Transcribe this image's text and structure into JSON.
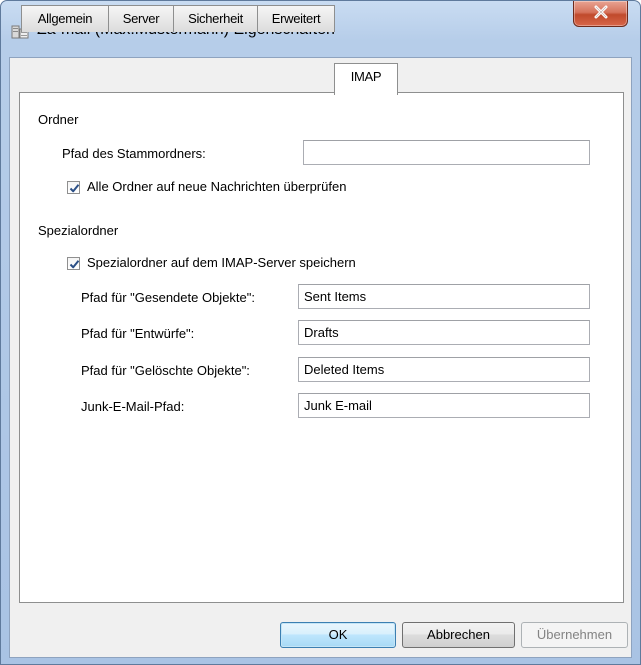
{
  "window": {
    "title": "Za-mail (Max.Mustermann) Eigenschaften"
  },
  "tabs": [
    {
      "label": "Allgemein",
      "active": false
    },
    {
      "label": "Server",
      "active": false
    },
    {
      "label": "Sicherheit",
      "active": false
    },
    {
      "label": "Erweitert",
      "active": false
    },
    {
      "label": "IMAP",
      "active": true
    }
  ],
  "ordner": {
    "heading": "Ordner",
    "root_path_label": "Pfad des Stammordners:",
    "root_path_value": "",
    "check_all_label": "Alle Ordner auf neue Nachrichten überprüfen",
    "check_all_checked": true
  },
  "spezial": {
    "heading": "Spezialordner",
    "store_label": "Spezialordner auf dem IMAP-Server speichern",
    "store_checked": true,
    "sent_label": "Pfad für \"Gesendete Objekte\":",
    "sent_value": "Sent Items",
    "drafts_label": "Pfad für \"Entwürfe\":",
    "drafts_value": "Drafts",
    "deleted_label": "Pfad für \"Gelöschte Objekte\":",
    "deleted_value": "Deleted Items",
    "junk_label": "Junk-E-Mail-Pfad:",
    "junk_value": "Junk E-mail"
  },
  "buttons": {
    "ok": "OK",
    "cancel": "Abbrechen",
    "apply": "Übernehmen"
  },
  "icons": {
    "title": "mail-account-icon",
    "close": "close-icon",
    "check": "checkmark-icon"
  },
  "colors": {
    "title_gradient_top": "#c9dcf2",
    "close_red": "#c04a2c",
    "check_blue": "#2b4f86",
    "default_button_border": "#3c7fb1"
  }
}
